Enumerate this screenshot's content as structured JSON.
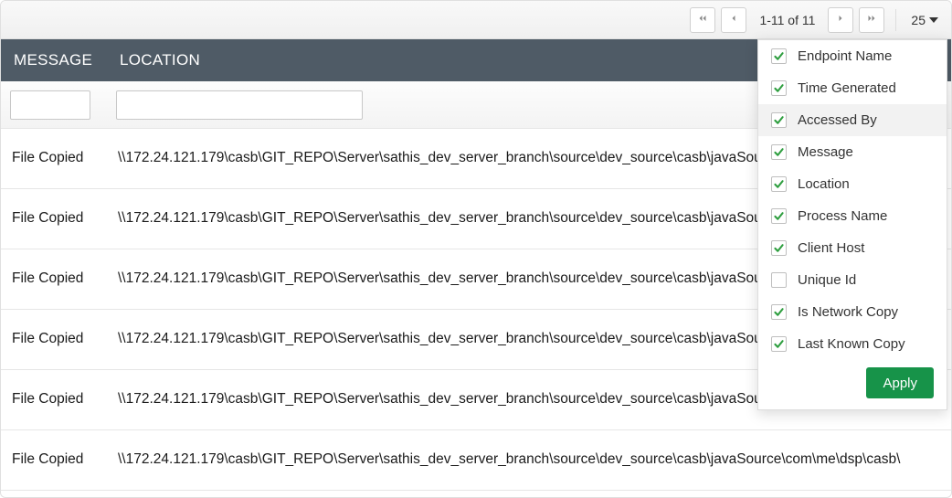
{
  "pagination": {
    "range_text": "1-11 of 11",
    "page_size": "25"
  },
  "columns": {
    "message": "MESSAGE",
    "location": "LOCATION"
  },
  "filters": {
    "message_value": "",
    "location_value": ""
  },
  "rows": [
    {
      "message": "File Copied",
      "location": "\\\\172.24.121.179\\casb\\GIT_REPO\\Server\\sathis_dev_server_branch\\source\\dev_source\\casb\\javaSource\\com\\me\\dsp\\casb\\"
    },
    {
      "message": "File Copied",
      "location": "\\\\172.24.121.179\\casb\\GIT_REPO\\Server\\sathis_dev_server_branch\\source\\dev_source\\casb\\javaSource\\com\\me\\dsp\\casb\\"
    },
    {
      "message": "File Copied",
      "location": "\\\\172.24.121.179\\casb\\GIT_REPO\\Server\\sathis_dev_server_branch\\source\\dev_source\\casb\\javaSource\\com\\me\\dsp\\casb\\"
    },
    {
      "message": "File Copied",
      "location": "\\\\172.24.121.179\\casb\\GIT_REPO\\Server\\sathis_dev_server_branch\\source\\dev_source\\casb\\javaSource\\com\\me\\dsp\\casb\\"
    },
    {
      "message": "File Copied",
      "location": "\\\\172.24.121.179\\casb\\GIT_REPO\\Server\\sathis_dev_server_branch\\source\\dev_source\\casb\\javaSource\\com\\me\\dsp\\casb\\"
    },
    {
      "message": "File Copied",
      "location": "\\\\172.24.121.179\\casb\\GIT_REPO\\Server\\sathis_dev_server_branch\\source\\dev_source\\casb\\javaSource\\com\\me\\dsp\\casb\\"
    }
  ],
  "column_chooser": {
    "items": [
      {
        "label": "Endpoint Name",
        "checked": true,
        "highlight": false
      },
      {
        "label": "Time Generated",
        "checked": true,
        "highlight": false
      },
      {
        "label": "Accessed By",
        "checked": true,
        "highlight": true
      },
      {
        "label": "Message",
        "checked": true,
        "highlight": false
      },
      {
        "label": "Location",
        "checked": true,
        "highlight": false
      },
      {
        "label": "Process Name",
        "checked": true,
        "highlight": false
      },
      {
        "label": "Client Host",
        "checked": true,
        "highlight": false
      },
      {
        "label": "Unique Id",
        "checked": false,
        "highlight": false
      },
      {
        "label": "Is Network Copy",
        "checked": true,
        "highlight": false
      },
      {
        "label": "Last Known Copy",
        "checked": true,
        "highlight": false
      }
    ],
    "apply_label": "Apply"
  }
}
